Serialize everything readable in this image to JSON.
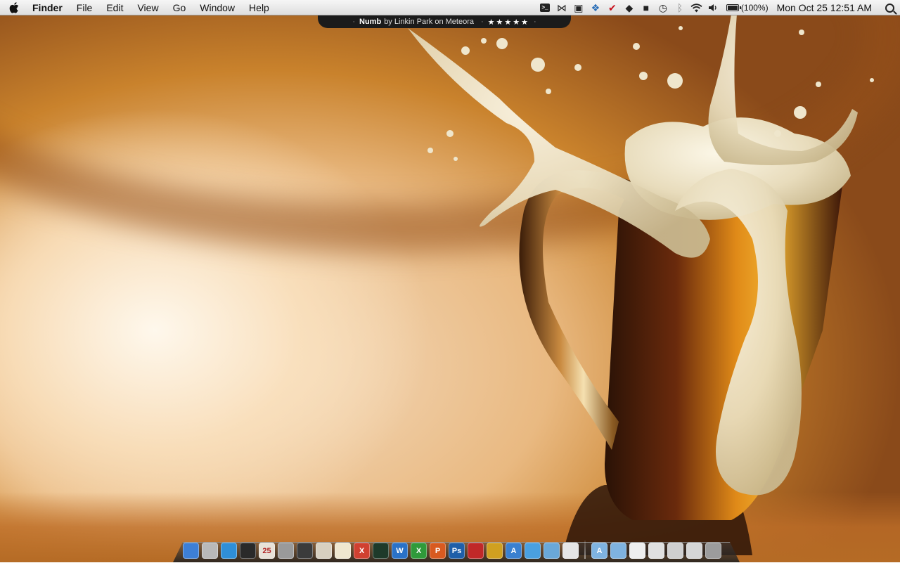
{
  "menubar": {
    "apple_icon": "apple-logo-icon",
    "app_name": "Finder",
    "menus": [
      "File",
      "Edit",
      "View",
      "Go",
      "Window",
      "Help"
    ],
    "status_icons": [
      {
        "name": "terminal-icon",
        "glyph": ">_"
      },
      {
        "name": "butterfly-icon",
        "glyph": "⋈"
      },
      {
        "name": "airplay-icon",
        "glyph": "▣"
      },
      {
        "name": "dropbox-icon",
        "glyph": "❖"
      },
      {
        "name": "checkmark-icon",
        "glyph": "✔"
      },
      {
        "name": "droplet-icon",
        "glyph": "◆"
      },
      {
        "name": "growl-icon",
        "glyph": "■"
      },
      {
        "name": "time-machine-icon",
        "glyph": "◷"
      },
      {
        "name": "bluetooth-icon",
        "glyph": "ᛒ"
      },
      {
        "name": "wifi-icon",
        "glyph": "◠"
      },
      {
        "name": "volume-icon",
        "glyph": "◂)"
      }
    ],
    "battery": {
      "icon": "battery-icon",
      "percent_label": "(100%)",
      "level": 1.0
    },
    "clock": "Mon Oct 25  12:51 AM",
    "spotlight_icon": "spotlight-search-icon"
  },
  "now_playing": {
    "track": "Numb",
    "by_text": "by Linkin Park on Meteora",
    "separator": "·",
    "stars": "★★★★★",
    "rating": 5
  },
  "wallpaper": {
    "subject": "beer mug with splashing foam",
    "colors": {
      "amber": "#c9822c",
      "cream": "#f4dcc0",
      "foam": "#e9e2c4",
      "beer": "#5a1e08"
    }
  },
  "dock": {
    "apps": [
      {
        "name": "finder-icon",
        "label": "",
        "color": "#3d7fd6"
      },
      {
        "name": "mail-icon",
        "label": "",
        "color": "#b9b9b9"
      },
      {
        "name": "safari-icon",
        "label": "",
        "color": "#2f8fd8"
      },
      {
        "name": "itunes-icon",
        "label": "",
        "color": "#2a2a2a"
      },
      {
        "name": "ical-icon",
        "label": "25",
        "color": "#e8e2d8"
      },
      {
        "name": "automator-icon",
        "label": "",
        "color": "#9a9a9a"
      },
      {
        "name": "quicktime-icon",
        "label": "",
        "color": "#3b3b3b"
      },
      {
        "name": "preview-icon",
        "label": "",
        "color": "#d8d0c0"
      },
      {
        "name": "textedit-icon",
        "label": "",
        "color": "#efe7cf"
      },
      {
        "name": "crossover-icon",
        "label": "X",
        "color": "#d04030"
      },
      {
        "name": "activity-monitor-icon",
        "label": "",
        "color": "#1e3a2a"
      },
      {
        "name": "word-icon",
        "label": "W",
        "color": "#2a72c8"
      },
      {
        "name": "excel-icon",
        "label": "X",
        "color": "#2f9a3a"
      },
      {
        "name": "powerpoint-icon",
        "label": "P",
        "color": "#d85a20"
      },
      {
        "name": "photoshop-icon",
        "label": "Ps",
        "color": "#1f5fa8"
      },
      {
        "name": "parallels-icon",
        "label": "",
        "color": "#c02828"
      },
      {
        "name": "transmit-icon",
        "label": "",
        "color": "#d0a020"
      },
      {
        "name": "xcode-icon",
        "label": "A",
        "color": "#3a80d0"
      },
      {
        "name": "messenger-icon",
        "label": "",
        "color": "#4aa0e0"
      },
      {
        "name": "iphoto-icon",
        "label": "",
        "color": "#6aa8d8"
      },
      {
        "name": "notes-icon",
        "label": "",
        "color": "#e6e6e6"
      }
    ],
    "stacks": [
      {
        "name": "applications-folder-icon",
        "label": "A",
        "color": "#7fb3e0"
      },
      {
        "name": "documents-folder-icon",
        "label": "",
        "color": "#7fb3e0"
      },
      {
        "name": "document-stack-icon",
        "label": "",
        "color": "#eeeeee"
      },
      {
        "name": "pictures-stack-icon",
        "label": "",
        "color": "#e0e0e0"
      },
      {
        "name": "downloads-stack-icon",
        "label": "",
        "color": "#cfcfcf"
      },
      {
        "name": "screenshots-stack-icon",
        "label": "",
        "color": "#d6d6d6"
      },
      {
        "name": "trash-icon",
        "label": "",
        "color": "#9c9c9c"
      }
    ]
  }
}
